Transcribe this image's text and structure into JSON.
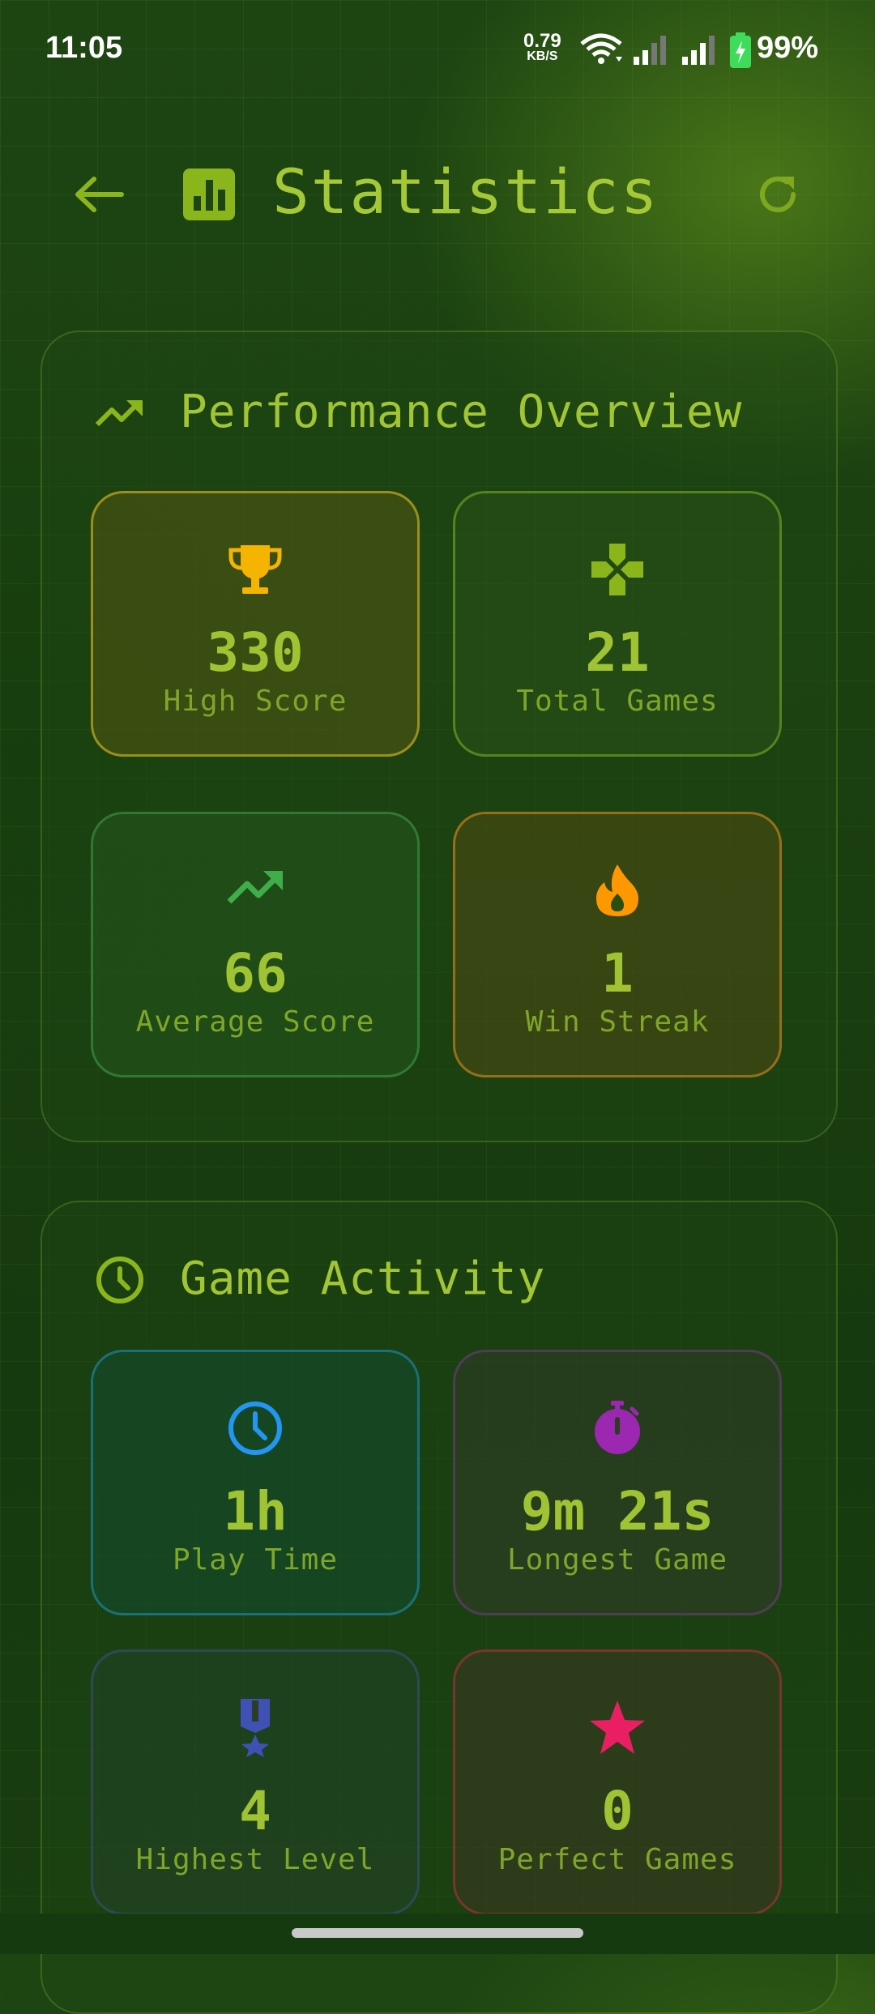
{
  "status_bar": {
    "time": "11:05",
    "net_speed": "0.79",
    "net_unit": "KB/S",
    "battery": "99%"
  },
  "app_bar": {
    "title": "Statistics",
    "title_icon": "bar-chart-icon",
    "back_icon": "arrow-back-icon",
    "refresh_icon": "refresh-icon"
  },
  "performance": {
    "title": "Performance Overview",
    "icon": "trending-up-icon",
    "stats": [
      {
        "value": "330",
        "label": "High Score",
        "icon": "trophy-icon",
        "color": "#f5b400"
      },
      {
        "value": "21",
        "label": "Total Games",
        "icon": "gamepad-icon",
        "color": "#8ab61c"
      },
      {
        "value": "66",
        "label": "Average Score",
        "icon": "trending-up-icon",
        "color": "#3fae4a"
      },
      {
        "value": "1",
        "label": "Win Streak",
        "icon": "fire-icon",
        "color": "#ff9800"
      }
    ]
  },
  "activity": {
    "title": "Game Activity",
    "icon": "clock-icon",
    "stats": [
      {
        "value": "1h",
        "label": "Play Time",
        "icon": "clock-icon",
        "color": "#2196f3"
      },
      {
        "value": "9m 21s",
        "label": "Longest Game",
        "icon": "stopwatch-icon",
        "color": "#9c27b0"
      },
      {
        "value": "4",
        "label": "Highest Level",
        "icon": "medal-icon",
        "color": "#3f51b5"
      },
      {
        "value": "0",
        "label": "Perfect Games",
        "icon": "star-icon",
        "color": "#e91e63"
      }
    ]
  }
}
